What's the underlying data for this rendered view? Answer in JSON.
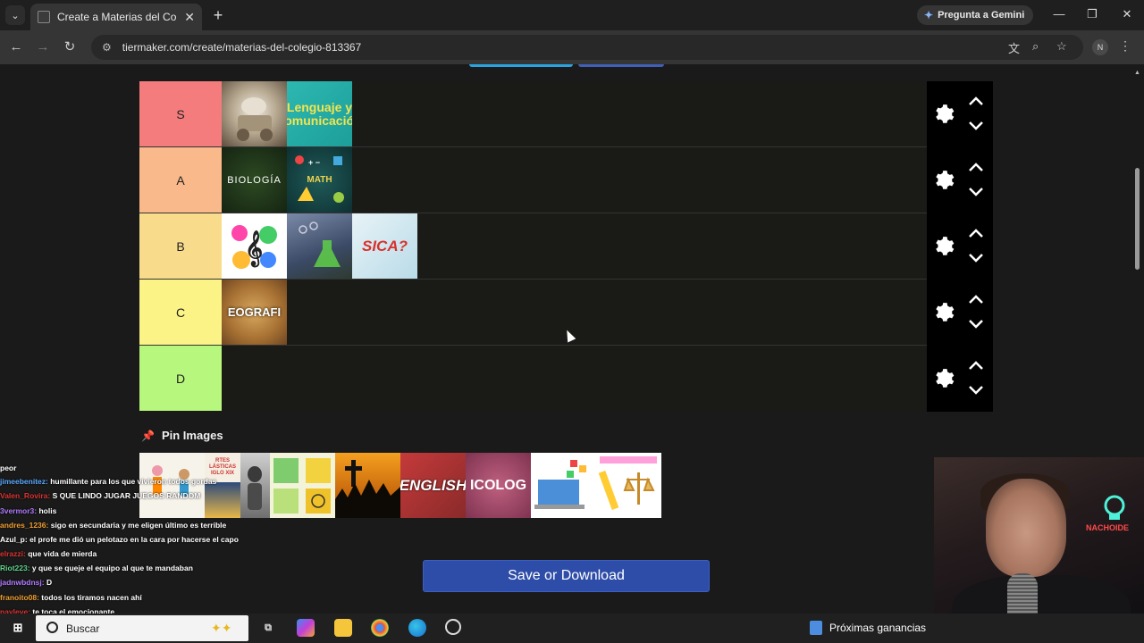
{
  "browser": {
    "tab_title": "Create a Materias del Colegio. T",
    "tab_close": "✕",
    "new_tab": "+",
    "gemini_label": "Pregunta a Gemini",
    "url": "tiermaker.com/create/materias-del-colegio-813367",
    "profile_initial": "N"
  },
  "tiers": [
    {
      "label": "S",
      "color": "#f47c7c",
      "items": [
        "Historia (estatua)",
        "Lenguaje y Comunicación"
      ]
    },
    {
      "label": "A",
      "color": "#f9b98a",
      "items": [
        "BIOLOGÍA",
        "MATH"
      ]
    },
    {
      "label": "B",
      "color": "#f9dc8b",
      "items": [
        "Música",
        "Química",
        "FÍSICA?"
      ]
    },
    {
      "label": "C",
      "color": "#fbf386",
      "items": [
        "GEOGRAFÍA"
      ]
    },
    {
      "label": "D",
      "color": "#b8f77d",
      "items": []
    }
  ],
  "tile_text": {
    "lenguaje": "Lenguaje y comunicación",
    "biologia": "BIOLOGÍA",
    "math": "MATH",
    "fisica": "SICA?",
    "geografia": "EOGRAFI",
    "artes": "RTES LÁSTICAS IGLO XIX",
    "english": "ENGLISH",
    "psicologia": "ICOLOG"
  },
  "pin_images_label": "Pin Images",
  "save_button": "Save or Download",
  "chat": [
    {
      "user": "",
      "color": "#ffffff",
      "text": "peor",
      "wrap": false
    },
    {
      "user": "jimeebenitez:",
      "color": "#5aa9ff",
      "text": "humillante para los que vivieron todos gordas",
      "wrap": true
    },
    {
      "user": "Valen_Rovira:",
      "color": "#d33",
      "text": "S QUE LINDO JUGAR JUEGOS RANDOM",
      "wrap": false
    },
    {
      "user": "3vermor3:",
      "color": "#b07aff",
      "text": "holis",
      "wrap": false
    },
    {
      "user": "andres_1236:",
      "color": "#f0a030",
      "text": "sigo en secundaria y me eligen último es terrible",
      "wrap": false
    },
    {
      "user": "Azul_p:",
      "color": "#ffffff",
      "text": "el profe me dió un pelotazo en la cara por hacerse el capo",
      "wrap": true
    },
    {
      "user": "elrazzi:",
      "color": "#d33",
      "text": "que vida de mierda",
      "wrap": false
    },
    {
      "user": "Riot223:",
      "color": "#5fd38a",
      "text": "y que se queje el equipo al que te mandaban",
      "wrap": false
    },
    {
      "user": "jadnwbdnsj:",
      "color": "#b07aff",
      "text": "D",
      "wrap": false
    },
    {
      "user": "franoito08:",
      "color": "#f0a030",
      "text": "todos los tiramos nacen ahí",
      "wrap": false
    },
    {
      "user": "nayleve:",
      "color": "#d33",
      "text": "te toca el emocionante",
      "wrap": false
    }
  ],
  "taskbar": {
    "search_placeholder": "Buscar",
    "status_text": "Próximas ganancias"
  },
  "webcam_sign": "NACHOIDE"
}
